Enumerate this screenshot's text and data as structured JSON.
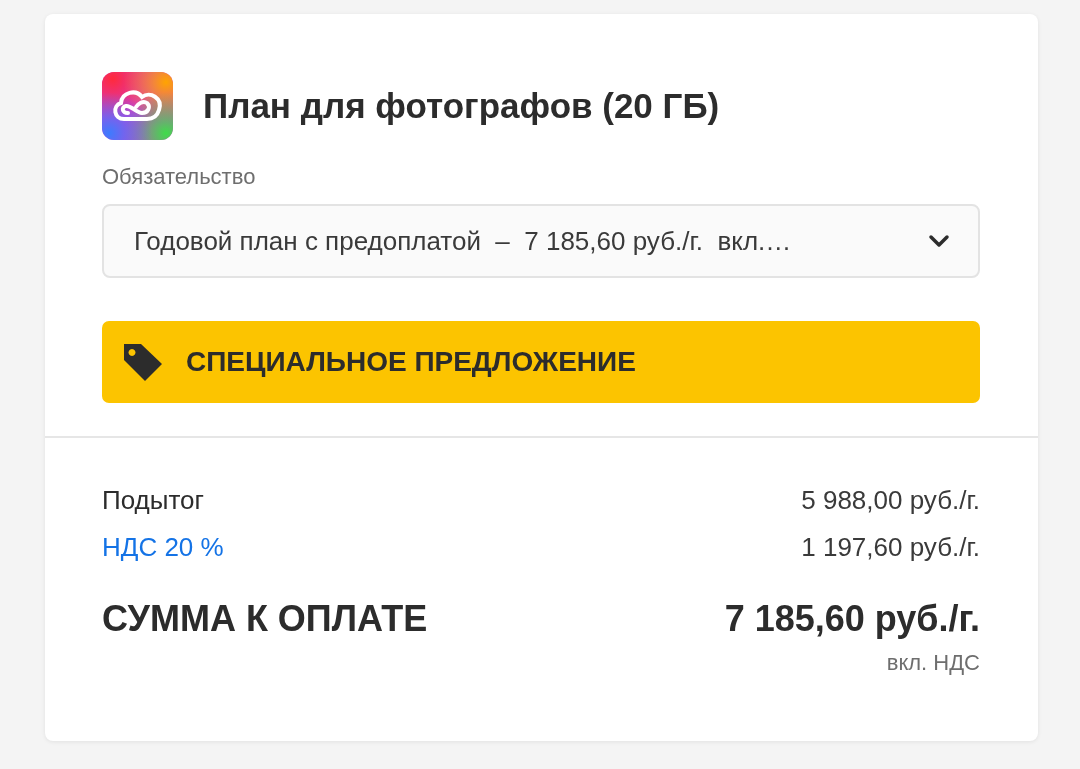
{
  "product": {
    "title": "План для фотографов (20 ГБ)"
  },
  "commitment": {
    "label": "Обязательство",
    "value": "Годовой план с предоплатой  –  7 185,60 руб./г.  вкл.…"
  },
  "offer_banner": {
    "text": "СПЕЦИАЛЬНОЕ ПРЕДЛОЖЕНИЕ"
  },
  "summary": {
    "rows": [
      {
        "kind": "plain",
        "label": "Подытог",
        "amount": "5 988,00 руб./г."
      },
      {
        "kind": "link",
        "label": "НДС 20 %",
        "amount": "1 197,60 руб./г."
      }
    ],
    "total": {
      "label": "СУММА К ОПЛАТЕ",
      "amount": "7 185,60 руб./г.",
      "note": "вкл. НДС"
    }
  }
}
